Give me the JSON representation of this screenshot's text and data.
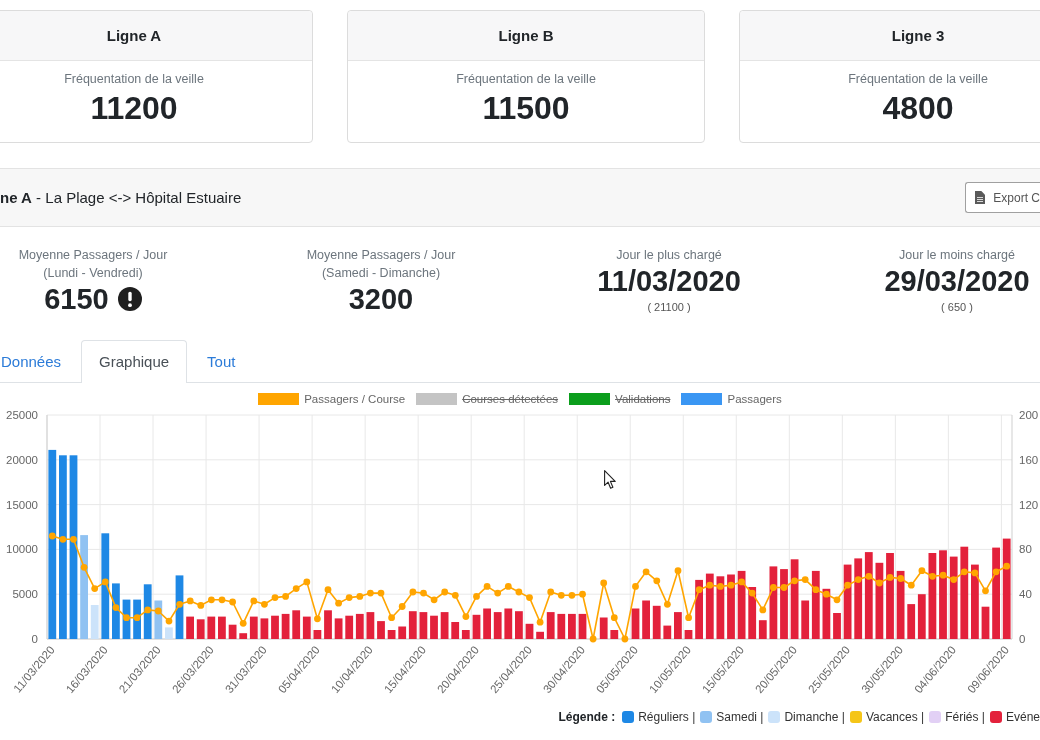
{
  "line_cards": [
    {
      "title": "Ligne A",
      "label": "Fréquentation de la veille",
      "value": "11200"
    },
    {
      "title": "Ligne B",
      "label": "Fréquentation de la veille",
      "value": "11500"
    },
    {
      "title": "Ligne 3",
      "label": "Fréquentation de la veille",
      "value": "4800"
    }
  ],
  "panel": {
    "title": "**ne A** - La Plage <-> Hôpital Estuaire",
    "export_button": "Export C",
    "stats": [
      {
        "label": "Moyenne Passagers / Jour",
        "subtitle": "(Lundi - Vendredi)",
        "value": "6150",
        "alert": true
      },
      {
        "label": "Moyenne Passagers / Jour",
        "subtitle": "(Samedi - Dimanche)",
        "value": "3200",
        "alert": false
      },
      {
        "label": "Jour le plus chargé",
        "value": "11/03/2020",
        "detail": "( 21100 )",
        "alert": false
      },
      {
        "label": "Jour le moins chargé",
        "value": "29/03/2020",
        "detail": "( 650 )",
        "alert": false
      }
    ],
    "tabs": [
      {
        "label": "Données",
        "selected": false
      },
      {
        "label": "Graphique",
        "selected": true
      },
      {
        "label": "Tout",
        "selected": false
      }
    ],
    "chart_legend": [
      {
        "label": "Passagers / Course",
        "color": "#ffa500",
        "hidden": false
      },
      {
        "label": "Courses détectées",
        "color": "#c4c4c4",
        "hidden": true
      },
      {
        "label": "Validations",
        "color": "#0b9e1c",
        "hidden": true
      },
      {
        "label": "Passagers",
        "color": "#3a96f3",
        "hidden": false
      }
    ],
    "chart_data": {
      "type": "bar",
      "grid": true,
      "ylim": [
        0,
        25000
      ],
      "yticks": [
        0,
        5000,
        10000,
        15000,
        20000,
        25000
      ],
      "y2lim": [
        0,
        200
      ],
      "y2ticks": [
        0,
        40,
        80,
        120,
        160,
        200
      ],
      "categories": [
        "11/03/2020",
        null,
        null,
        null,
        null,
        "16/03/2020",
        null,
        null,
        null,
        null,
        "21/03/2020",
        null,
        null,
        null,
        null,
        "26/03/2020",
        null,
        null,
        null,
        null,
        "31/03/2020",
        null,
        null,
        null,
        null,
        "05/04/2020",
        null,
        null,
        null,
        null,
        "10/04/2020",
        null,
        null,
        null,
        null,
        "15/04/2020",
        null,
        null,
        null,
        null,
        "20/04/2020",
        null,
        null,
        null,
        null,
        "25/04/2020",
        null,
        null,
        null,
        null,
        "30/04/2020",
        null,
        null,
        null,
        null,
        "05/05/2020",
        null,
        null,
        null,
        null,
        "10/05/2020",
        null,
        null,
        null,
        null,
        "15/05/2020",
        null,
        null,
        null,
        null,
        "20/05/2020",
        null,
        null,
        null,
        null,
        "25/05/2020",
        null,
        null,
        null,
        null,
        "30/05/2020",
        null,
        null,
        null,
        null,
        "04/06/2020",
        null,
        null,
        null,
        null,
        "09/06/2020"
      ],
      "series": [
        {
          "values": [
            21100,
            20500,
            20500,
            11600,
            3800,
            11800,
            6200,
            4400,
            4400,
            6100,
            4300,
            1300,
            7100,
            2500,
            2200,
            2500,
            2500,
            1600,
            650,
            2500,
            2300,
            2600,
            2800,
            3200,
            2500,
            1000,
            3200,
            2300,
            2600,
            2800,
            3000,
            2000,
            1000,
            1400,
            3100,
            3000,
            2600,
            3000,
            1900,
            1000,
            2700,
            3400,
            3000,
            3400,
            3100,
            1700,
            800,
            3000,
            2800,
            2800,
            2800,
            0,
            2400,
            1000,
            0,
            3400,
            4300,
            3700,
            1500,
            3000,
            1000,
            6600,
            7300,
            7000,
            7200,
            7600,
            5800,
            2100,
            8100,
            7800,
            8900,
            4300,
            7600,
            5600,
            2900,
            8300,
            9000,
            9700,
            8500,
            9600,
            7600,
            3900,
            5000,
            9600,
            9900,
            9200,
            10300,
            8300,
            3600,
            10200,
            11200
          ],
          "colors": [
            "#1e88e5",
            "#1e88e5",
            "#1e88e5",
            "#90c2f2",
            "#cce3fa",
            "#1e88e5",
            "#1e88e5",
            "#1e88e5",
            "#1e88e5",
            "#1e88e5",
            "#90c2f2",
            "#cce3fa",
            "#1e88e5",
            "#e3213b",
            "#e3213b",
            "#e3213b",
            "#e3213b",
            "#e3213b",
            "#e3213b",
            "#e3213b",
            "#e3213b",
            "#e3213b",
            "#e3213b",
            "#e3213b",
            "#e3213b",
            "#e3213b",
            "#e3213b",
            "#e3213b",
            "#e3213b",
            "#e3213b",
            "#e3213b",
            "#e3213b",
            "#e3213b",
            "#e3213b",
            "#e3213b",
            "#e3213b",
            "#e3213b",
            "#e3213b",
            "#e3213b",
            "#e3213b",
            "#e3213b",
            "#e3213b",
            "#e3213b",
            "#e3213b",
            "#e3213b",
            "#e3213b",
            "#e3213b",
            "#e3213b",
            "#e3213b",
            "#e3213b",
            "#e3213b",
            null,
            "#e3213b",
            "#e3213b",
            null,
            "#e3213b",
            "#e3213b",
            "#e3213b",
            "#e3213b",
            "#e3213b",
            "#e3213b",
            "#e3213b",
            "#e3213b",
            "#e3213b",
            "#e3213b",
            "#e3213b",
            "#e3213b",
            "#e3213b",
            "#e3213b",
            "#e3213b",
            "#e3213b",
            "#e3213b",
            "#e3213b",
            "#e3213b",
            "#e3213b",
            "#e3213b",
            "#e3213b",
            "#e3213b",
            "#e3213b",
            "#e3213b",
            "#e3213b",
            "#e3213b",
            "#e3213b",
            "#e3213b",
            "#e3213b",
            "#e3213b",
            "#e3213b",
            "#e3213b",
            "#e3213b",
            "#e3213b",
            "#e3213b"
          ]
        },
        {
          "type": "line",
          "axis": "y2",
          "color": "#ffa500",
          "marker": "circle",
          "values": [
            92,
            89,
            89,
            64,
            45,
            51,
            28,
            19,
            19,
            26,
            25,
            16,
            31,
            34,
            30,
            35,
            35,
            33,
            14,
            34,
            31,
            37,
            38,
            45,
            51,
            18,
            44,
            32,
            37,
            38,
            41,
            41,
            19,
            29,
            42,
            41,
            35,
            42,
            39,
            20,
            38,
            47,
            41,
            47,
            42,
            37,
            15,
            42,
            39,
            39,
            40,
            0,
            50,
            19,
            0,
            47,
            60,
            52,
            31,
            61,
            19,
            44,
            48,
            47,
            48,
            51,
            41,
            26,
            46,
            46,
            52,
            53,
            44,
            40,
            35,
            48,
            53,
            56,
            50,
            55,
            54,
            48,
            61,
            56,
            57,
            53,
            60,
            59,
            43,
            60,
            65
          ]
        }
      ]
    },
    "day_legend": {
      "title": "Légende :",
      "items": [
        {
          "label": "Réguliers |",
          "color": "#1e88e5"
        },
        {
          "label": "Samedi |",
          "color": "#90c2f2"
        },
        {
          "label": "Dimanche |",
          "color": "#cce3fa"
        },
        {
          "label": "Vacances |",
          "color": "#f5c518"
        },
        {
          "label": "Fériés |",
          "color": "#e2d0f5"
        },
        {
          "label": "Evéne",
          "color": "#e3213b"
        }
      ]
    }
  }
}
